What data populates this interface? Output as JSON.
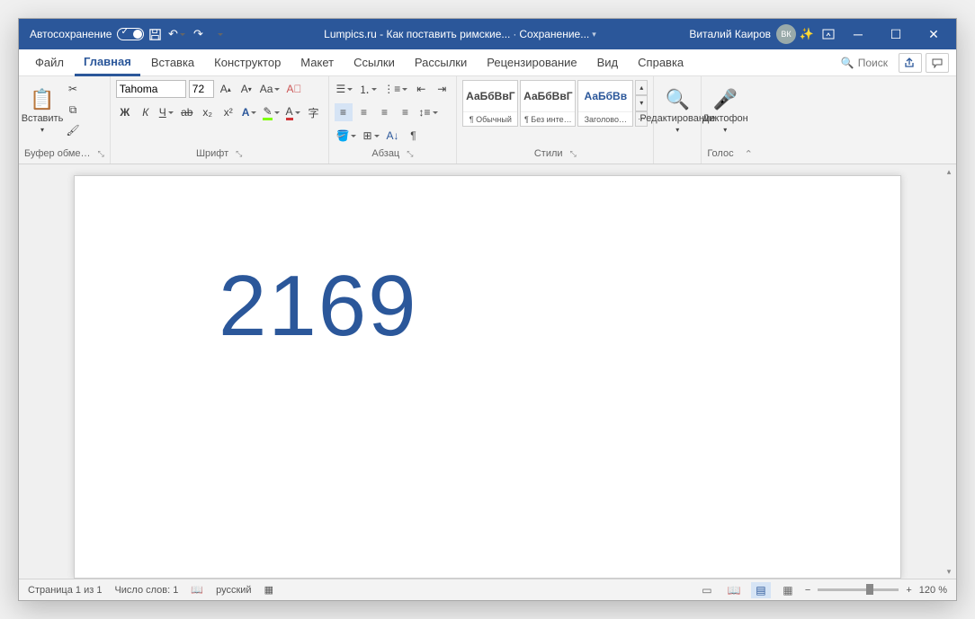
{
  "title": {
    "autosave": "Автосохранение",
    "doc": "Lumpics.ru - Как поставить римские...",
    "saving": "Сохранение...",
    "user": "Виталий Каиров",
    "initials": "ВК"
  },
  "tabs": {
    "file": "Файл",
    "home": "Главная",
    "insert": "Вставка",
    "design": "Конструктор",
    "layout": "Макет",
    "refs": "Ссылки",
    "mail": "Рассылки",
    "review": "Рецензирование",
    "view": "Вид",
    "help": "Справка",
    "search": "Поиск"
  },
  "ribbon": {
    "clipboard": {
      "paste": "Вставить",
      "label": "Буфер обме…"
    },
    "font": {
      "name": "Tahoma",
      "size": "72",
      "label": "Шрифт",
      "bold": "Ж",
      "italic": "К",
      "underline": "Ч",
      "strike": "ab",
      "sub": "x₂",
      "sup": "x²"
    },
    "para": {
      "label": "Абзац"
    },
    "styles": {
      "label": "Стили",
      "s1": {
        "preview": "АаБбВвГ",
        "name": "¶ Обычный"
      },
      "s2": {
        "preview": "АаБбВвГ",
        "name": "¶ Без инте…"
      },
      "s3": {
        "preview": "АаБбВв",
        "name": "Заголово…"
      }
    },
    "edit": "Редактирование",
    "voice": {
      "btn": "Диктофон",
      "label": "Голос"
    }
  },
  "document": {
    "text": "2169"
  },
  "status": {
    "page": "Страница 1 из 1",
    "words": "Число слов: 1",
    "lang": "русский",
    "zoom": "120 %"
  }
}
